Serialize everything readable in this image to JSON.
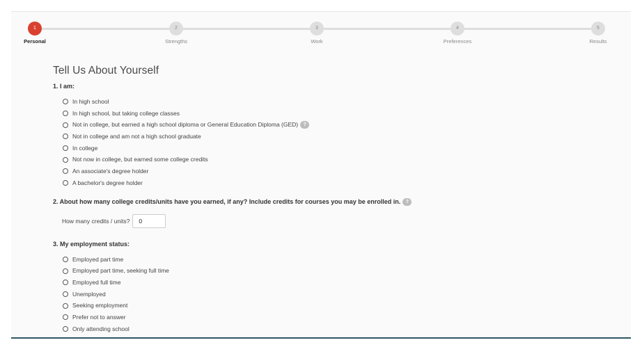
{
  "stepper": {
    "steps": [
      {
        "number": "1",
        "label": "Personal"
      },
      {
        "number": "2",
        "label": "Strengths"
      },
      {
        "number": "3",
        "label": "Work"
      },
      {
        "number": "4",
        "label": "Preferences"
      },
      {
        "number": "5",
        "label": "Results"
      }
    ],
    "active_step": 1
  },
  "page": {
    "title": "Tell Us About Yourself"
  },
  "q1": {
    "text": "1. I am:",
    "options": [
      "In high school",
      "In high school, but taking college classes",
      "Not in college, but earned a high school diploma or General Education Diploma (GED)",
      "Not in college and am not a high school graduate",
      "In college",
      "Not now in college, but earned some college credits",
      "An associate's degree holder",
      "A bachelor's degree holder"
    ]
  },
  "q2": {
    "text": "2. About how many college credits/units have you earned, if any? Include credits for courses you may be enrolled in.",
    "input_label": "How many credits / units?",
    "input_value": "0"
  },
  "q3": {
    "text": "3. My employment status:",
    "options": [
      "Employed part time",
      "Employed part time, seeking full time",
      "Employed full time",
      "Unemployed",
      "Seeking employment",
      "Prefer not to answer",
      "Only attending school"
    ]
  },
  "help_icon_glyph": "?",
  "colors": {
    "active_step": "#d9402f",
    "inactive_step": "#dedede",
    "footer_bar": "#2e5560"
  }
}
